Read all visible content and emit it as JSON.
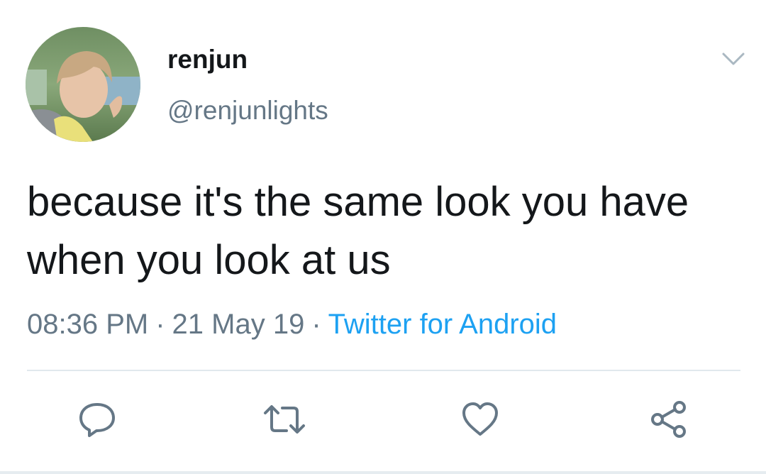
{
  "user": {
    "display_name": "renjun",
    "handle": "@renjunlights",
    "avatar_icon": "profile-photo"
  },
  "tweet": {
    "text": "because it's the same look you have when you look at us",
    "time": "08:36 PM",
    "date": "21 May 19",
    "source": "Twitter for Android",
    "separator": "·"
  },
  "icons": {
    "menu": "chevron-down-icon",
    "reply": "reply-icon",
    "retweet": "retweet-icon",
    "like": "heart-icon",
    "share": "share-icon"
  },
  "colors": {
    "text": "#14171a",
    "secondary": "#657786",
    "link": "#1da1f2",
    "icon": "#657786",
    "divider": "#e1e8ed"
  }
}
